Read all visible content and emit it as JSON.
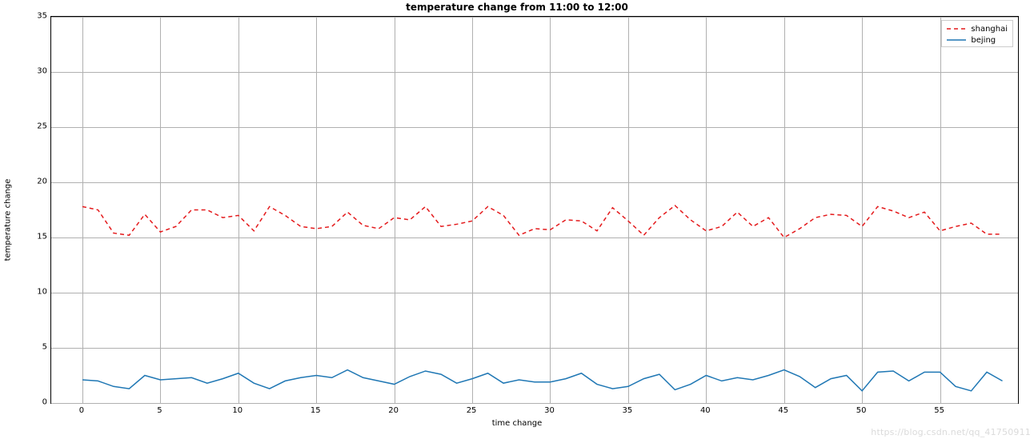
{
  "chart_data": {
    "type": "line",
    "title": "temperature change from 11:00 to 12:00",
    "xlabel": "time change",
    "ylabel": "temperature change",
    "xlim": [
      -2,
      60
    ],
    "ylim": [
      0,
      35
    ],
    "xticks": [
      0,
      5,
      10,
      15,
      20,
      25,
      30,
      35,
      40,
      45,
      50,
      55
    ],
    "yticks": [
      0,
      5,
      10,
      15,
      20,
      25,
      30,
      35
    ],
    "x": [
      0,
      1,
      2,
      3,
      4,
      5,
      6,
      7,
      8,
      9,
      10,
      11,
      12,
      13,
      14,
      15,
      16,
      17,
      18,
      19,
      20,
      21,
      22,
      23,
      24,
      25,
      26,
      27,
      28,
      29,
      30,
      31,
      32,
      33,
      34,
      35,
      36,
      37,
      38,
      39,
      40,
      41,
      42,
      43,
      44,
      45,
      46,
      47,
      48,
      49,
      50,
      51,
      52,
      53,
      54,
      55,
      56,
      57,
      58,
      59
    ],
    "series": [
      {
        "name": "shanghai",
        "color": "#e41a1c",
        "dash": "5,4",
        "values": [
          17.8,
          17.5,
          15.4,
          15.2,
          17.1,
          15.5,
          16.0,
          17.5,
          17.5,
          16.8,
          17.0,
          15.6,
          17.8,
          17.0,
          16.0,
          15.8,
          16.0,
          17.3,
          16.1,
          15.8,
          16.8,
          16.6,
          17.8,
          16.0,
          16.2,
          16.5,
          17.8,
          17.0,
          15.2,
          15.8,
          15.7,
          16.6,
          16.5,
          15.6,
          17.7,
          16.5,
          15.2,
          16.8,
          17.9,
          16.6,
          15.6,
          16.0,
          17.3,
          16.0,
          16.8,
          15.0,
          15.8,
          16.8,
          17.1,
          17.0,
          16.0,
          17.8,
          17.4,
          16.8,
          17.3,
          15.6,
          16.0,
          16.3,
          15.3,
          15.3
        ]
      },
      {
        "name": "bejing",
        "color": "#1f77b4",
        "dash": "",
        "values": [
          2.1,
          2.0,
          1.5,
          1.3,
          2.5,
          2.1,
          2.2,
          2.3,
          1.8,
          2.2,
          2.7,
          1.8,
          1.3,
          2.0,
          2.3,
          2.5,
          2.3,
          3.0,
          2.3,
          2.0,
          1.7,
          2.4,
          2.9,
          2.6,
          1.8,
          2.2,
          2.7,
          1.8,
          2.1,
          1.9,
          1.9,
          2.2,
          2.7,
          1.7,
          1.3,
          1.5,
          2.2,
          2.6,
          1.2,
          1.7,
          2.5,
          2.0,
          2.3,
          2.1,
          2.5,
          3.0,
          2.4,
          1.4,
          2.2,
          2.5,
          1.1,
          2.8,
          2.9,
          2.0,
          2.8,
          2.8,
          1.5,
          1.1,
          2.8,
          2.0
        ]
      }
    ],
    "legend": {
      "position": "upper right"
    }
  },
  "watermark": "https://blog.csdn.net/qq_41750911"
}
